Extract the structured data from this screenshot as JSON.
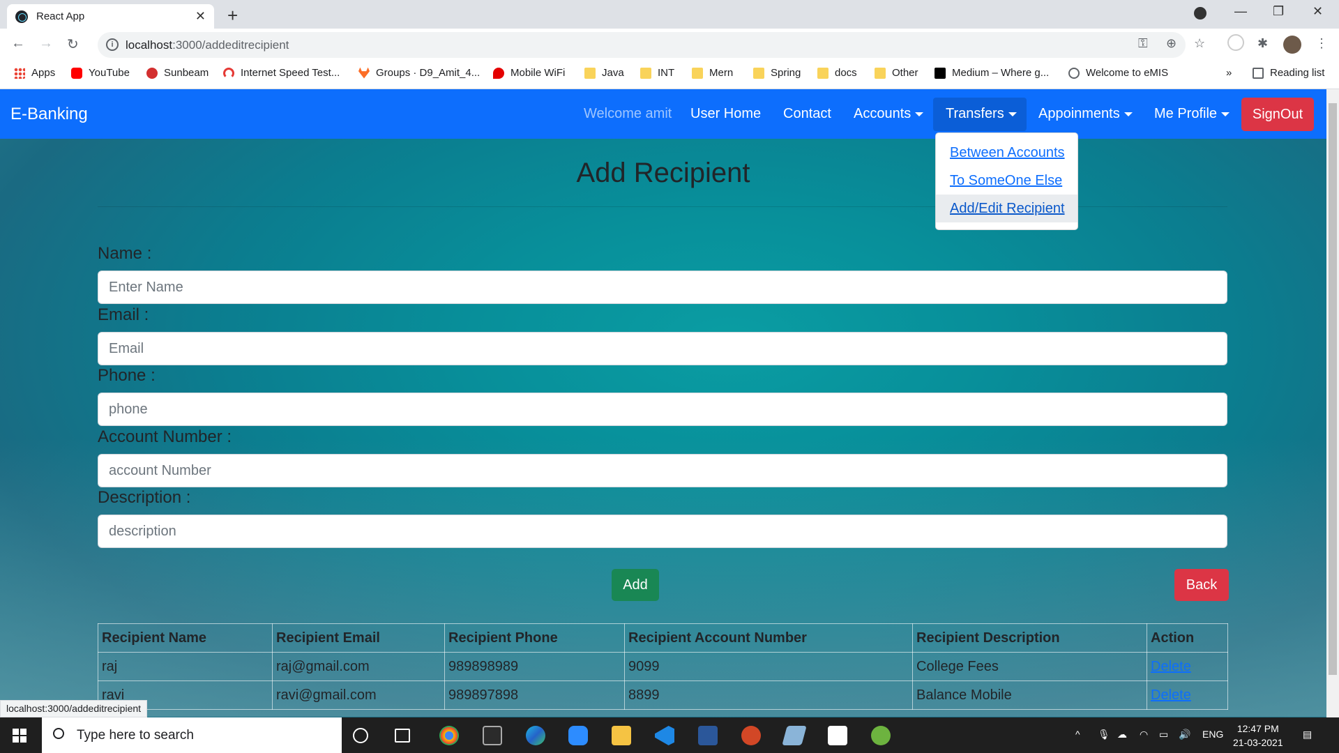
{
  "browser": {
    "tab_title": "React App",
    "url_host": "localhost",
    "url_path": ":3000/addeditrecipient",
    "bookmarks": [
      {
        "label": "Apps",
        "icon": "apps-grid-icon"
      },
      {
        "label": "YouTube",
        "icon": "youtube-icon"
      },
      {
        "label": "Sunbeam",
        "icon": "sunbeam-icon"
      },
      {
        "label": "Internet Speed Test...",
        "icon": "speedometer-icon"
      },
      {
        "label": "Groups · D9_Amit_4...",
        "icon": "gitlab-icon"
      },
      {
        "label": "Mobile WiFi",
        "icon": "airtel-icon"
      },
      {
        "label": "Java",
        "icon": "folder-icon"
      },
      {
        "label": "INT",
        "icon": "folder-icon"
      },
      {
        "label": "Mern",
        "icon": "folder-icon"
      },
      {
        "label": "Spring",
        "icon": "folder-icon"
      },
      {
        "label": "docs",
        "icon": "folder-icon"
      },
      {
        "label": "Other",
        "icon": "folder-icon"
      },
      {
        "label": "Medium – Where g...",
        "icon": "medium-icon"
      },
      {
        "label": "Welcome to eMIS",
        "icon": "globe-icon"
      }
    ],
    "more_bookmarks": "»",
    "reading_list": "Reading list",
    "status_url": "localhost:3000/addeditrecipient"
  },
  "navbar": {
    "brand": "E-Banking",
    "welcome": "Welcome amit",
    "user_home": "User Home",
    "contact": "Contact",
    "accounts": "Accounts",
    "transfers": "Transfers",
    "appoinments": "Appoinments",
    "me_profile": "Me Profile",
    "signout": "SignOut",
    "colors": {
      "navbar": "#0d6efd",
      "signout": "#dc3545"
    }
  },
  "transfers_menu": {
    "items": [
      "Between Accounts",
      "To SomeOne Else",
      "Add/Edit Recipient"
    ]
  },
  "form": {
    "title": "Add Recipient",
    "name_label": "Name :",
    "name_placeholder": "Enter Name",
    "email_label": "Email :",
    "email_placeholder": "Email",
    "phone_label": "Phone :",
    "phone_placeholder": "phone",
    "account_label": "Account Number :",
    "account_placeholder": "account Number",
    "description_label": "Description :",
    "description_placeholder": "description",
    "add_button": "Add",
    "back_button": "Back",
    "colors": {
      "add": "#198754",
      "back": "#dc3545"
    }
  },
  "table": {
    "headers": [
      "Recipient Name",
      "Recipient Email",
      "Recipient Phone",
      "Recipient Account Number",
      "Recipient Description",
      "Action"
    ],
    "rows": [
      [
        "raj",
        "raj@gmail.com",
        "989898989",
        "9099",
        "College Fees",
        "Delete"
      ],
      [
        "ravi",
        "ravi@gmail.com",
        "989897898",
        "8899",
        "Balance Mobile",
        "Delete"
      ]
    ]
  },
  "taskbar": {
    "search_placeholder": "Type here to search",
    "language": "ENG",
    "time": "12:47 PM",
    "date": "21-03-2021"
  }
}
